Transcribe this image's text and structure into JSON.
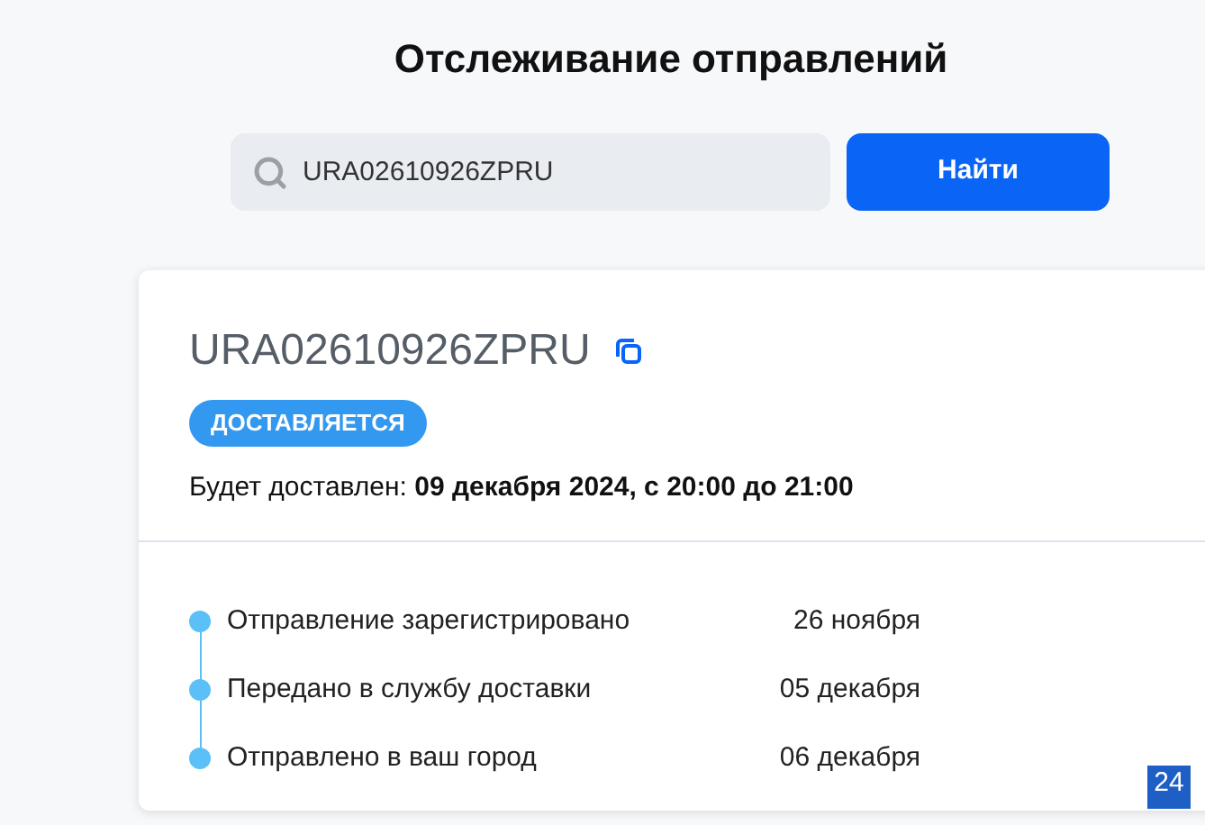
{
  "title": "Отслеживание отправлений",
  "search": {
    "value": "URA02610926ZPRU",
    "button": "Найти"
  },
  "shipment": {
    "number": "URA02610926ZPRU",
    "status": "ДОСТАВЛЯЕТСЯ",
    "delivery_label": "Будет доставлен:",
    "delivery_value": "09 декабря 2024, с 20:00 до 21:00"
  },
  "events": [
    {
      "label": "Отправление зарегистрировано",
      "date": "26 ноября"
    },
    {
      "label": "Передано в службу доставки",
      "date": "05 декабря"
    },
    {
      "label": "Отправлено в ваш город",
      "date": "06 декабря"
    }
  ],
  "widget_badge": "24"
}
